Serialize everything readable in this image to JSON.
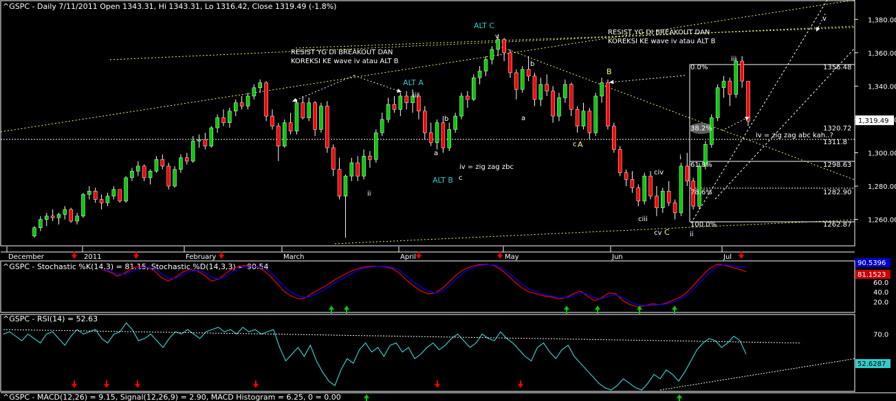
{
  "colors": {
    "background": "#000000",
    "up": "#00cc00",
    "down": "#ff0000",
    "frame": "#ffffff",
    "stoch_k": "#ff0000",
    "stoch_d": "#0000ff",
    "rsi": "#33cccc",
    "annotation": "#ffff66",
    "cyan_label": "#33cccc",
    "signal_up": "#00cc00",
    "signal_down": "#ff0000",
    "guide_line": "#ffff66",
    "price_tag_bg": "#ffffff"
  },
  "header": {
    "title": "^GSPC - Daily 7/11/2011 Open 1343.31, Hi 1343.31, Lo 1316.42, Close 1319.49 (-1.8%)"
  },
  "chart_data": [
    {
      "type": "candlestick",
      "title": "^GSPC - Daily 7/11/2011 Open 1343.31, Hi 1343.31, Lo 1316.42, Close 1319.49 (-1.8%)",
      "ylim": [
        1245,
        1390
      ],
      "y_ticks": [
        "1,260.00",
        "1,280.00",
        "1,300.00",
        "1,320.00",
        "1,340.00",
        "1,360.00",
        "1,380.00"
      ],
      "x_labels": [
        "December",
        "2011",
        "February",
        "March",
        "April",
        "May",
        "Jun",
        "Jul"
      ],
      "last_close": "1,319.49",
      "candles": [
        [
          1250,
          1256,
          1249,
          1255
        ],
        [
          1255,
          1262,
          1253,
          1260
        ],
        [
          1260,
          1264,
          1256,
          1262
        ],
        [
          1262,
          1266,
          1259,
          1261
        ],
        [
          1261,
          1264,
          1257,
          1263
        ],
        [
          1263,
          1268,
          1260,
          1266
        ],
        [
          1266,
          1267,
          1258,
          1259
        ],
        [
          1259,
          1264,
          1257,
          1262
        ],
        [
          1262,
          1276,
          1261,
          1275
        ],
        [
          1275,
          1280,
          1272,
          1277
        ],
        [
          1277,
          1279,
          1270,
          1272
        ],
        [
          1272,
          1275,
          1266,
          1270
        ],
        [
          1270,
          1276,
          1268,
          1274
        ],
        [
          1274,
          1280,
          1272,
          1278
        ],
        [
          1278,
          1276,
          1270,
          1271
        ],
        [
          1271,
          1286,
          1270,
          1285
        ],
        [
          1285,
          1291,
          1283,
          1289
        ],
        [
          1289,
          1295,
          1286,
          1292
        ],
        [
          1292,
          1293,
          1283,
          1285
        ],
        [
          1285,
          1290,
          1281,
          1289
        ],
        [
          1289,
          1298,
          1288,
          1296
        ],
        [
          1296,
          1299,
          1290,
          1292
        ],
        [
          1292,
          1294,
          1278,
          1280
        ],
        [
          1280,
          1292,
          1279,
          1290
        ],
        [
          1290,
          1299,
          1288,
          1297
        ],
        [
          1297,
          1300,
          1293,
          1295
        ],
        [
          1295,
          1310,
          1294,
          1307
        ],
        [
          1307,
          1311,
          1303,
          1308
        ],
        [
          1308,
          1312,
          1302,
          1304
        ],
        [
          1304,
          1316,
          1303,
          1315
        ],
        [
          1315,
          1323,
          1312,
          1321
        ],
        [
          1321,
          1326,
          1316,
          1318
        ],
        [
          1318,
          1327,
          1315,
          1325
        ],
        [
          1325,
          1332,
          1322,
          1330
        ],
        [
          1330,
          1334,
          1326,
          1328
        ],
        [
          1328,
          1336,
          1326,
          1334
        ],
        [
          1334,
          1341,
          1332,
          1339
        ],
        [
          1339,
          1344,
          1336,
          1342
        ],
        [
          1342,
          1343,
          1319,
          1322
        ],
        [
          1322,
          1326,
          1314,
          1316
        ],
        [
          1316,
          1318,
          1295,
          1304
        ],
        [
          1304,
          1320,
          1303,
          1318
        ],
        [
          1318,
          1324,
          1311,
          1313
        ],
        [
          1313,
          1332,
          1311,
          1330
        ],
        [
          1330,
          1334,
          1320,
          1321
        ],
        [
          1321,
          1333,
          1319,
          1330
        ],
        [
          1330,
          1331,
          1310,
          1314
        ],
        [
          1314,
          1330,
          1312,
          1328
        ],
        [
          1328,
          1331,
          1300,
          1303
        ],
        [
          1303,
          1305,
          1286,
          1290
        ],
        [
          1290,
          1297,
          1272,
          1274
        ],
        [
          1274,
          1287,
          1249,
          1286
        ],
        [
          1286,
          1297,
          1283,
          1294
        ],
        [
          1294,
          1298,
          1283,
          1286
        ],
        [
          1286,
          1302,
          1284,
          1298
        ],
        [
          1298,
          1301,
          1291,
          1296
        ],
        [
          1296,
          1314,
          1294,
          1312
        ],
        [
          1312,
          1324,
          1310,
          1320
        ],
        [
          1320,
          1333,
          1318,
          1329
        ],
        [
          1329,
          1334,
          1324,
          1326
        ],
        [
          1326,
          1336,
          1322,
          1334
        ],
        [
          1334,
          1337,
          1326,
          1330
        ],
        [
          1330,
          1338,
          1324,
          1334
        ],
        [
          1334,
          1336,
          1320,
          1325
        ],
        [
          1325,
          1328,
          1308,
          1312
        ],
        [
          1312,
          1318,
          1304,
          1306
        ],
        [
          1306,
          1320,
          1302,
          1318
        ],
        [
          1318,
          1322,
          1300,
          1303
        ],
        [
          1303,
          1318,
          1301,
          1314
        ],
        [
          1314,
          1324,
          1312,
          1322
        ],
        [
          1322,
          1336,
          1320,
          1334
        ],
        [
          1334,
          1337,
          1327,
          1332
        ],
        [
          1332,
          1347,
          1331,
          1345
        ],
        [
          1345,
          1352,
          1341,
          1349
        ],
        [
          1349,
          1358,
          1346,
          1356
        ],
        [
          1356,
          1364,
          1353,
          1362
        ],
        [
          1362,
          1371,
          1358,
          1368
        ],
        [
          1368,
          1369,
          1355,
          1360
        ],
        [
          1360,
          1362,
          1345,
          1348
        ],
        [
          1348,
          1350,
          1332,
          1338
        ],
        [
          1338,
          1352,
          1336,
          1350
        ],
        [
          1350,
          1358,
          1343,
          1346
        ],
        [
          1346,
          1348,
          1328,
          1332
        ],
        [
          1332,
          1345,
          1328,
          1341
        ],
        [
          1341,
          1347,
          1334,
          1337
        ],
        [
          1337,
          1340,
          1318,
          1322
        ],
        [
          1322,
          1336,
          1319,
          1333
        ],
        [
          1333,
          1344,
          1330,
          1341
        ],
        [
          1341,
          1342,
          1322,
          1326
        ],
        [
          1326,
          1328,
          1312,
          1316
        ],
        [
          1316,
          1330,
          1314,
          1325
        ],
        [
          1325,
          1327,
          1308,
          1312
        ],
        [
          1312,
          1336,
          1310,
          1334
        ],
        [
          1334,
          1345,
          1330,
          1342
        ],
        [
          1342,
          1344,
          1314,
          1316
        ],
        [
          1316,
          1318,
          1300,
          1302
        ],
        [
          1302,
          1304,
          1286,
          1288
        ],
        [
          1288,
          1290,
          1280,
          1284
        ],
        [
          1284,
          1289,
          1276,
          1279
        ],
        [
          1279,
          1281,
          1268,
          1271
        ],
        [
          1271,
          1288,
          1269,
          1286
        ],
        [
          1286,
          1289,
          1272,
          1274
        ],
        [
          1274,
          1280,
          1262,
          1267
        ],
        [
          1267,
          1279,
          1264,
          1277
        ],
        [
          1277,
          1283,
          1268,
          1270
        ],
        [
          1270,
          1272,
          1260,
          1264
        ],
        [
          1264,
          1294,
          1262,
          1292
        ],
        [
          1292,
          1300,
          1280,
          1283
        ],
        [
          1283,
          1285,
          1266,
          1268
        ],
        [
          1268,
          1294,
          1266,
          1292
        ],
        [
          1292,
          1307,
          1290,
          1305
        ],
        [
          1305,
          1323,
          1303,
          1321
        ],
        [
          1321,
          1341,
          1319,
          1339
        ],
        [
          1339,
          1346,
          1333,
          1343
        ],
        [
          1343,
          1345,
          1328,
          1335
        ],
        [
          1335,
          1357,
          1333,
          1355
        ],
        [
          1355,
          1358,
          1339,
          1343
        ],
        [
          1343,
          1343,
          1316,
          1319
        ]
      ]
    },
    {
      "type": "line",
      "title": "^GSPC - Stochastic %K(14,3) = 81.15, Stochastic %D(14,3,3) = 90.54",
      "ylim": [
        0,
        100
      ],
      "y_ticks": [
        "20.0",
        "40.0",
        "60.0",
        "80.0"
      ],
      "series": [
        {
          "name": "Stochastic %K(14,3)",
          "last": "81.1523",
          "values": [
            85,
            80,
            72,
            78,
            88,
            92,
            90,
            84,
            70,
            62,
            70,
            80,
            86,
            83,
            74,
            62,
            66,
            78,
            88,
            92,
            94,
            92,
            86,
            74,
            58,
            42,
            32,
            26,
            28,
            38,
            46,
            54,
            64,
            72,
            80,
            86,
            90,
            92,
            92,
            91,
            88,
            78,
            64,
            52,
            42,
            36,
            38,
            48,
            62,
            76,
            86,
            92,
            95,
            96,
            94,
            86,
            74,
            60,
            48,
            40,
            36,
            32,
            30,
            26,
            28,
            36,
            42,
            32,
            22,
            28,
            38,
            36,
            22,
            14,
            10,
            12,
            16,
            14,
            18,
            24,
            30,
            42,
            58,
            74,
            88,
            96,
            94,
            90,
            86,
            81
          ]
        },
        {
          "name": "Stochastic %D(14,3,3)",
          "last": "90.5396",
          "values": [
            86,
            82,
            76,
            76,
            82,
            88,
            90,
            88,
            78,
            68,
            68,
            74,
            82,
            84,
            80,
            70,
            66,
            72,
            82,
            88,
            92,
            92,
            90,
            82,
            68,
            52,
            40,
            32,
            29,
            32,
            40,
            48,
            58,
            66,
            74,
            82,
            88,
            90,
            92,
            92,
            90,
            84,
            72,
            60,
            50,
            42,
            38,
            42,
            54,
            68,
            80,
            88,
            93,
            95,
            95,
            90,
            80,
            68,
            56,
            46,
            40,
            35,
            32,
            29,
            28,
            32,
            38,
            36,
            28,
            26,
            32,
            34,
            28,
            20,
            14,
            12,
            13,
            14,
            16,
            20,
            26,
            36,
            50,
            66,
            80,
            92,
            95,
            93,
            91,
            90.5
          ]
        }
      ]
    },
    {
      "type": "line",
      "title": "^GSPC - RSI(14) = 52.63",
      "ylim": [
        20,
        85
      ],
      "y_ticks": [
        "70.0"
      ],
      "series": [
        {
          "name": "RSI(14)",
          "last": "52.6287",
          "values": [
            70,
            72,
            68,
            64,
            70,
            66,
            62,
            70,
            72,
            66,
            60,
            68,
            74,
            70,
            72,
            74,
            66,
            62,
            70,
            72,
            80,
            74,
            64,
            66,
            70,
            64,
            58,
            66,
            72,
            70,
            74,
            70,
            66,
            72,
            74,
            76,
            72,
            74,
            70,
            76,
            72,
            74,
            70,
            72,
            74,
            58,
            46,
            52,
            58,
            50,
            60,
            46,
            36,
            28,
            24,
            38,
            48,
            44,
            56,
            62,
            54,
            58,
            50,
            60,
            62,
            54,
            58,
            48,
            52,
            58,
            62,
            56,
            60,
            66,
            70,
            64,
            58,
            62,
            70,
            66,
            64,
            72,
            66,
            62,
            56,
            50,
            46,
            58,
            62,
            54,
            48,
            56,
            60,
            50,
            44,
            38,
            32,
            26,
            22,
            20,
            24,
            30,
            26,
            22,
            20,
            26,
            34,
            30,
            38,
            34,
            28,
            36,
            46,
            56,
            62,
            66,
            64,
            58,
            62,
            68,
            64,
            52
          ]
        }
      ]
    },
    {
      "type": "line",
      "title": "^GSPC - MACD(12,26) = 9.15, Signal(12,26,9) = 2.90, MACD Histogram = 6.25, 0 = 0.00"
    }
  ],
  "annotations": {
    "resist_left": [
      "RESIST YG DI BREAKOUT DAN",
      "KOREKSI KE wave iv atau ALT B"
    ],
    "resist_right": [
      "RESIST YG DI BREAKOUT DAN",
      "KOREKSI KE wave iv atau ALT B"
    ],
    "alt_c": "ALT C",
    "v_top": "v",
    "alt_a": "ALT A",
    "iii_mid": "iii",
    "a_mid": "a",
    "b_mid": "b",
    "c_mid": "c",
    "iv_zig": "iv = zig zag zbc",
    "alt_b": "ALT B",
    "ii_left": "ii",
    "a_may": "a",
    "b_may": "b",
    "b_yellow": "B",
    "c_small": "c",
    "a_cyan": "A",
    "i_jun": "i",
    "civ": "civ",
    "ciii": "ciii",
    "cv": "cv",
    "c_yellow": "C",
    "ii_jun": "ii",
    "iii_jul": "iii",
    "iv_jul": "iv = zig zag abc kah..?",
    "v_right": "v"
  },
  "fib_levels": [
    {
      "pct": "0.0%",
      "value": "1356.48"
    },
    {
      "pct": "38.2%",
      "value": "1320.72"
    },
    {
      "pct": "",
      "value": "1311.8"
    },
    {
      "pct": "61.8%",
      "value": "1298.63"
    },
    {
      "pct": "78.6%",
      "value": "1282.90"
    },
    {
      "pct": "100.0%",
      "value": "1262.87"
    }
  ]
}
